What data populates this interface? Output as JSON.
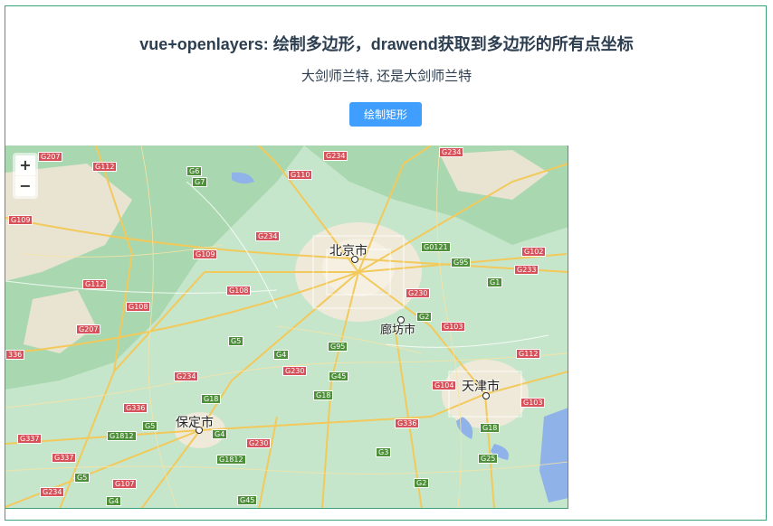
{
  "page": {
    "title": "vue+openlayers: 绘制多边形，drawend获取到多边形的所有点坐标",
    "subtitle": "大剑师兰特, 还是大剑师兰特",
    "draw_button_label": "绘制矩形"
  },
  "map": {
    "zoom_in_label": "+",
    "zoom_out_label": "−",
    "cities": {
      "beijing": "北京市",
      "langfang": "廊坊市",
      "tianjin": "天津市",
      "baoding": "保定市"
    },
    "road_labels": [
      {
        "id": "r1",
        "text": "G207",
        "type": "g"
      },
      {
        "id": "r2",
        "text": "G112",
        "type": "g"
      },
      {
        "id": "r3",
        "text": "G6",
        "type": "n"
      },
      {
        "id": "r4",
        "text": "G7",
        "type": "n"
      },
      {
        "id": "r5",
        "text": "G110",
        "type": "g"
      },
      {
        "id": "r6",
        "text": "G234",
        "type": "g"
      },
      {
        "id": "r7",
        "text": "G234",
        "type": "g"
      },
      {
        "id": "r8",
        "text": "G109",
        "type": "g"
      },
      {
        "id": "r9",
        "text": "G234",
        "type": "g"
      },
      {
        "id": "r10",
        "text": "G109",
        "type": "g"
      },
      {
        "id": "r11",
        "text": "G0121",
        "type": "n"
      },
      {
        "id": "r12",
        "text": "G102",
        "type": "g"
      },
      {
        "id": "r13",
        "text": "G95",
        "type": "n"
      },
      {
        "id": "r14",
        "text": "G233",
        "type": "g"
      },
      {
        "id": "r15",
        "text": "G112",
        "type": "g"
      },
      {
        "id": "r16",
        "text": "G108",
        "type": "g"
      },
      {
        "id": "r17",
        "text": "G1",
        "type": "n"
      },
      {
        "id": "r18",
        "text": "G230",
        "type": "g"
      },
      {
        "id": "r19",
        "text": "G108",
        "type": "g"
      },
      {
        "id": "r20",
        "text": "G2",
        "type": "n"
      },
      {
        "id": "r21",
        "text": "G207",
        "type": "g"
      },
      {
        "id": "r22",
        "text": "G103",
        "type": "g"
      },
      {
        "id": "r23",
        "text": "G5",
        "type": "n"
      },
      {
        "id": "r24",
        "text": "G95",
        "type": "n"
      },
      {
        "id": "r25",
        "text": "G4",
        "type": "n"
      },
      {
        "id": "r26",
        "text": "G112",
        "type": "g"
      },
      {
        "id": "r27",
        "text": "336",
        "type": "g"
      },
      {
        "id": "r28",
        "text": "G230",
        "type": "g"
      },
      {
        "id": "r29",
        "text": "G234",
        "type": "g"
      },
      {
        "id": "r30",
        "text": "G45",
        "type": "n"
      },
      {
        "id": "r31",
        "text": "G104",
        "type": "g"
      },
      {
        "id": "r32",
        "text": "G18",
        "type": "n"
      },
      {
        "id": "r33",
        "text": "G18",
        "type": "n"
      },
      {
        "id": "r34",
        "text": "G103",
        "type": "g"
      },
      {
        "id": "r35",
        "text": "G336",
        "type": "g"
      },
      {
        "id": "r36",
        "text": "G5",
        "type": "n"
      },
      {
        "id": "r37",
        "text": "G336",
        "type": "g"
      },
      {
        "id": "r38",
        "text": "G18",
        "type": "n"
      },
      {
        "id": "r39",
        "text": "G337",
        "type": "g"
      },
      {
        "id": "r40",
        "text": "G1812",
        "type": "n"
      },
      {
        "id": "r41",
        "text": "G4",
        "type": "n"
      },
      {
        "id": "r42",
        "text": "G230",
        "type": "g"
      },
      {
        "id": "r43",
        "text": "G337",
        "type": "g"
      },
      {
        "id": "r44",
        "text": "G1812",
        "type": "n"
      },
      {
        "id": "r45",
        "text": "G3",
        "type": "n"
      },
      {
        "id": "r46",
        "text": "G25",
        "type": "n"
      },
      {
        "id": "r47",
        "text": "G5",
        "type": "n"
      },
      {
        "id": "r48",
        "text": "G107",
        "type": "g"
      },
      {
        "id": "r49",
        "text": "G2",
        "type": "n"
      },
      {
        "id": "r50",
        "text": "G234",
        "type": "g"
      },
      {
        "id": "r51",
        "text": "G4",
        "type": "n"
      },
      {
        "id": "r52",
        "text": "G45",
        "type": "n"
      }
    ]
  }
}
